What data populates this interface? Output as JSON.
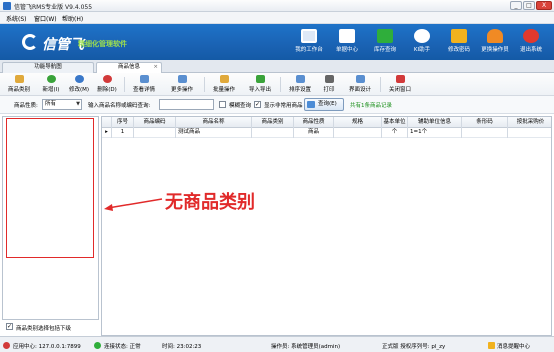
{
  "window": {
    "title": "信管飞RMS专业版 V9.4.055",
    "minimize": "_",
    "restore": "□",
    "close": "X"
  },
  "menu": {
    "items": [
      "系统(S)",
      "窗口(W)",
      "帮助(H)"
    ]
  },
  "banner": {
    "logo": "信管飞",
    "slogan": "精细化管理软件",
    "nav": [
      {
        "label": "我的工作台",
        "icon": "monitor-icon"
      },
      {
        "label": "单据中心",
        "icon": "document-icon"
      },
      {
        "label": "库存查询",
        "icon": "book-icon"
      },
      {
        "label": "KI助手",
        "icon": "info-icon"
      },
      {
        "label": "修改密码",
        "icon": "lock-icon"
      },
      {
        "label": "更换操作员",
        "icon": "user-icon"
      },
      {
        "label": "退出系统",
        "icon": "power-icon"
      }
    ]
  },
  "tabs": [
    {
      "label": "功能导航图",
      "active": false
    },
    {
      "label": "商品信息",
      "active": true,
      "close": "×"
    }
  ],
  "toolbar": {
    "items": [
      {
        "label": "商品类别",
        "icon": "folder-icon",
        "color": "#e0a93b"
      },
      {
        "label": "新增(I)",
        "icon": "add-icon",
        "color": "#3aa33a"
      },
      {
        "label": "修改(M)",
        "icon": "edit-icon",
        "color": "#3a78c9"
      },
      {
        "label": "删除(D)",
        "icon": "delete-icon",
        "color": "#d23a3a"
      },
      {
        "label": "查看详情",
        "icon": "view-icon",
        "color": "#5a8fd0"
      },
      {
        "label": "更多操作",
        "icon": "more-icon",
        "color": "#5a8fd0"
      },
      {
        "label": "批量操作",
        "icon": "batch-icon",
        "color": "#e0a93b"
      },
      {
        "label": "导入导出",
        "icon": "import-export-icon",
        "color": "#3aa33a"
      },
      {
        "label": "排序设置",
        "icon": "sort-icon",
        "color": "#5a8fd0"
      },
      {
        "label": "打印",
        "icon": "print-icon",
        "color": "#666666"
      },
      {
        "label": "界面设计",
        "icon": "design-icon",
        "color": "#5a8fd0"
      },
      {
        "label": "关闭窗口",
        "icon": "close-window-icon",
        "color": "#d23a3a"
      }
    ]
  },
  "filter": {
    "nature_label": "商品性质:",
    "nature_value": "所有",
    "search_label": "输入商品名称或编码查询:",
    "search_value": "",
    "fuzzy_label": "模糊查询",
    "fuzzy_checked": false,
    "show_common_label": "显示非常用商品",
    "show_common_checked": true,
    "query_button": "查询(E)",
    "count_text": "共有1条商品记录"
  },
  "left_footer": {
    "label": "商品类别选择包括下级",
    "checked": true
  },
  "grid": {
    "columns": [
      "序号",
      "商品编码",
      "商品名称",
      "商品类别",
      "商品性质",
      "规格",
      "基本单位",
      "辅助单位信息",
      "条形码",
      "按批采购价"
    ],
    "rows": [
      {
        "marker": "▸",
        "cells": [
          "1",
          "",
          "测试商品",
          "",
          "商品",
          "",
          "个",
          "1=1个",
          "",
          ""
        ]
      }
    ]
  },
  "annotation": {
    "text": "无商品类别",
    "color": "#e12a2a"
  },
  "status": {
    "server": "应用中心: 127.0.0.1:7899",
    "connection": "连接状态: 正常",
    "time": "时间: 23:02:23",
    "operator": "操作员: 系统管理员(admin)",
    "edition": "正式版 授权序列号: pl_zy",
    "messages": "消息提醒中心"
  }
}
